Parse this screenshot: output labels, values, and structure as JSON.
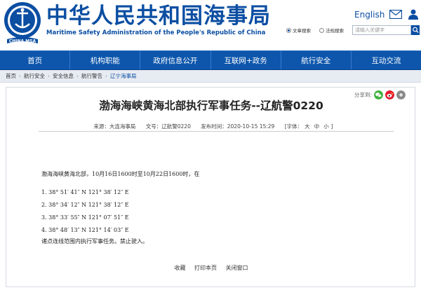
{
  "header": {
    "logo_text": "CHINA MSA",
    "title_cn": "中华人民共和国海事局",
    "title_en": "Maritime Safety Administration of the People's Republic of China",
    "english_link": "English",
    "search_scope": [
      "文章搜索",
      "法规搜索"
    ],
    "search_placeholder": "请输入关键字"
  },
  "nav": [
    "首页",
    "机构职能",
    "政府信息公开",
    "互联网+政务",
    "航行安全",
    "互动交流"
  ],
  "breadcrumb": [
    "首页",
    "航行安全",
    "安全信息",
    "航行警告",
    "辽宁海事局"
  ],
  "share_label": "分享到:",
  "article": {
    "title": "渤海海峡黄海北部执行军事任务--辽航警0220",
    "source": "来源：大连海事局",
    "doc_no": "文号：辽航警0220",
    "publish_time": "发布时间：2020-10-15 15:29",
    "font_label": "[字体：",
    "font_sizes": [
      "大",
      "中",
      "小"
    ],
    "font_close": "]",
    "intro": "渤海海峡黄海北部，10月16日1600时至10月22日1600时，在",
    "coords": [
      "1. 38° 51′ 41″ N  121° 38′ 12″ E",
      "2. 38° 34′ 12″ N  121° 38′ 12″ E",
      "3. 38° 33′ 55″ N  121° 07′ 51″ E",
      "4. 38° 48′ 13″ N  121° 14′ 03″ E"
    ],
    "closing": "诸点连线范围内执行军事任务。禁止驶入。"
  },
  "actions": [
    "收藏",
    "打印本页",
    "关闭窗口"
  ],
  "colors": {
    "brand_blue": "#0b4ea2",
    "nav_bg": "#0d56ac",
    "wechat": "#3fb33f",
    "weibo": "#e6162d"
  }
}
